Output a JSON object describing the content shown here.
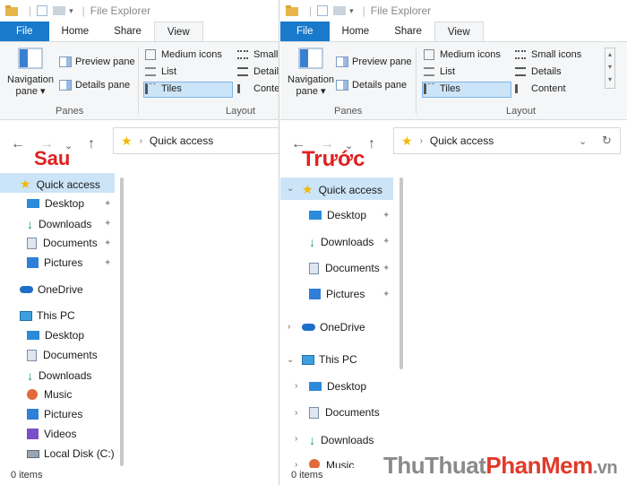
{
  "left": {
    "title": "File Explorer",
    "tabs": [
      "File",
      "Home",
      "Share",
      "View"
    ],
    "ribbon": {
      "navigation_pane": "Navigation",
      "navigation_pane_2": "pane",
      "preview_pane": "Preview pane",
      "details_pane": "Details pane",
      "panes_label": "Panes",
      "medium_icons": "Medium icons",
      "list": "List",
      "tiles": "Tiles",
      "small": "Small",
      "detail": "Detail",
      "conte": "Conte",
      "layout_label": "Layout"
    },
    "address": "Quick access",
    "caption": "Sau",
    "tree": {
      "quick_access": "Quick access",
      "desktop": "Desktop",
      "downloads": "Downloads",
      "documents": "Documents",
      "pictures": "Pictures",
      "onedrive": "OneDrive",
      "this_pc": "This PC",
      "pc_desktop": "Desktop",
      "pc_documents": "Documents",
      "pc_downloads": "Downloads",
      "pc_music": "Music",
      "pc_pictures": "Pictures",
      "pc_videos": "Videos",
      "pc_local_disk": "Local Disk (C:)"
    },
    "status": "0 items"
  },
  "right": {
    "title": "File Explorer",
    "tabs": [
      "File",
      "Home",
      "Share",
      "View"
    ],
    "ribbon": {
      "navigation_pane": "Navigation",
      "navigation_pane_2": "pane",
      "preview_pane": "Preview pane",
      "details_pane": "Details pane",
      "panes_label": "Panes",
      "medium_icons": "Medium icons",
      "list": "List",
      "tiles": "Tiles",
      "small_icons": "Small icons",
      "details": "Details",
      "content": "Content",
      "layout_label": "Layout"
    },
    "address": "Quick access",
    "caption": "Trước",
    "tree": {
      "quick_access": "Quick access",
      "desktop": "Desktop",
      "downloads": "Downloads",
      "documents": "Documents",
      "pictures": "Pictures",
      "onedrive": "OneDrive",
      "this_pc": "This PC",
      "pc_desktop": "Desktop",
      "pc_documents": "Documents",
      "pc_downloads": "Downloads",
      "pc_music": "Music"
    },
    "status": "0 items"
  },
  "watermark": {
    "part1": "ThuThuat",
    "part2": "PhanMem",
    "part3": ".vn"
  },
  "colors": {
    "file_tab": "#1979ca",
    "selection": "#cce4f7",
    "caption": "#e02020",
    "watermark_grey": "#8a8a8a",
    "watermark_red": "#e03a2a"
  }
}
